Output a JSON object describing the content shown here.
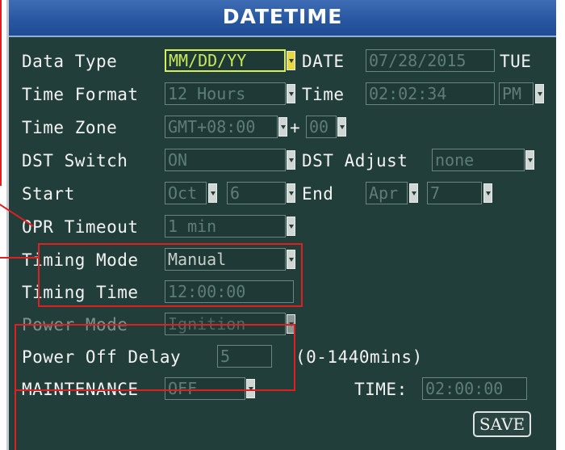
{
  "title": "DATETIME",
  "rows": {
    "data_type": {
      "label": "Data Type",
      "value": "MM/DD/YY"
    },
    "date": {
      "label": "DATE",
      "value": "07/28/2015",
      "day": "TUE"
    },
    "time_format": {
      "label": "Time Format",
      "value": "12 Hours"
    },
    "time": {
      "label": "Time",
      "value": "02:02:34",
      "ampm": "PM"
    },
    "time_zone": {
      "label": "Time Zone",
      "value": "GMT+08:00",
      "plus": "+",
      "offset": "00"
    },
    "dst_switch": {
      "label": "DST Switch",
      "value": "ON"
    },
    "dst_adjust": {
      "label": "DST Adjust",
      "value": "none"
    },
    "start": {
      "label": "Start",
      "month": "Oct",
      "day": "6"
    },
    "end": {
      "label": "End",
      "month": "Apr",
      "day": "7"
    },
    "opr_timeout": {
      "label": "OPR Timeout",
      "value": "1 min"
    },
    "timing_mode": {
      "label": "Timing Mode",
      "value": "Manual"
    },
    "timing_time": {
      "label": "Timing Time",
      "value": "12:00:00"
    },
    "power_mode": {
      "label": "Power Mode",
      "value": "Ignition"
    },
    "power_off_delay": {
      "label": "Power Off Delay",
      "value": "5",
      "hint": "(0-1440mins)"
    },
    "maintenance": {
      "label": "MAINTENANCE",
      "value": "OFF"
    },
    "maint_time": {
      "label": "TIME:",
      "value": "02:00:00"
    }
  },
  "save_label": "SAVE",
  "colors": {
    "background": "#223e3a",
    "title_bar": "#2756a0",
    "annotation": "#e02020",
    "selected": "#d5f05a"
  }
}
